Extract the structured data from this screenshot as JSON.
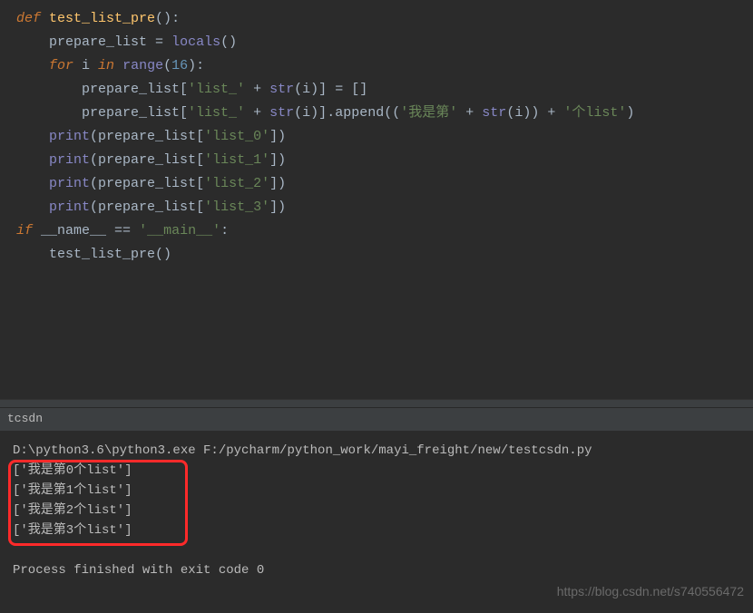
{
  "code": {
    "lines": [
      {
        "indent": 0,
        "tokens": [
          [
            "kw",
            "def "
          ],
          [
            "fn",
            "test_list_pre"
          ],
          [
            "paren",
            "()"
          ],
          [
            "op",
            ":"
          ]
        ]
      },
      {
        "indent": 1,
        "tokens": [
          [
            "",
            "prepare_list "
          ],
          [
            "op",
            "="
          ],
          [
            "",
            " "
          ],
          [
            "builtin",
            "locals"
          ],
          [
            "paren",
            "()"
          ]
        ]
      },
      {
        "indent": 1,
        "tokens": [
          [
            "kw",
            "for "
          ],
          [
            "",
            "i "
          ],
          [
            "kw",
            "in "
          ],
          [
            "builtin",
            "range"
          ],
          [
            "paren",
            "("
          ],
          [
            "num",
            "16"
          ],
          [
            "paren",
            ")"
          ],
          [
            "op",
            ":"
          ]
        ]
      },
      {
        "indent": 2,
        "tokens": [
          [
            "",
            "prepare_list"
          ],
          [
            "bracket",
            "["
          ],
          [
            "str",
            "'list_'"
          ],
          [
            "",
            " "
          ],
          [
            "op",
            "+"
          ],
          [
            "",
            " "
          ],
          [
            "builtin",
            "str"
          ],
          [
            "paren",
            "("
          ],
          [
            "",
            "i"
          ],
          [
            "paren",
            ")"
          ],
          [
            "bracket",
            "]"
          ],
          [
            "",
            " "
          ],
          [
            "op",
            "="
          ],
          [
            "",
            " "
          ],
          [
            "bracket",
            "[]"
          ]
        ]
      },
      {
        "indent": 2,
        "tokens": [
          [
            "",
            "prepare_list"
          ],
          [
            "bracket",
            "["
          ],
          [
            "str",
            "'list_'"
          ],
          [
            "",
            " "
          ],
          [
            "op",
            "+"
          ],
          [
            "",
            " "
          ],
          [
            "builtin",
            "str"
          ],
          [
            "paren",
            "("
          ],
          [
            "",
            "i"
          ],
          [
            "paren",
            ")"
          ],
          [
            "bracket",
            "]"
          ],
          [
            "dot",
            "."
          ],
          [
            "",
            "append"
          ],
          [
            "paren",
            "(("
          ],
          [
            "str",
            "'我是第'"
          ],
          [
            "",
            " "
          ],
          [
            "op",
            "+"
          ],
          [
            "",
            " "
          ],
          [
            "builtin",
            "str"
          ],
          [
            "paren",
            "("
          ],
          [
            "",
            "i"
          ],
          [
            "paren",
            "))"
          ],
          [
            "",
            " "
          ],
          [
            "op",
            "+"
          ],
          [
            "",
            " "
          ],
          [
            "str",
            "'个list'"
          ],
          [
            "paren",
            ")"
          ]
        ]
      },
      {
        "indent": 1,
        "tokens": [
          [
            "builtin",
            "print"
          ],
          [
            "paren",
            "("
          ],
          [
            "",
            "prepare_list"
          ],
          [
            "bracket",
            "["
          ],
          [
            "str",
            "'list_0'"
          ],
          [
            "bracket",
            "]"
          ],
          [
            "paren",
            ")"
          ]
        ]
      },
      {
        "indent": 1,
        "tokens": [
          [
            "builtin",
            "print"
          ],
          [
            "paren",
            "("
          ],
          [
            "",
            "prepare_list"
          ],
          [
            "bracket",
            "["
          ],
          [
            "str",
            "'list_1'"
          ],
          [
            "bracket",
            "]"
          ],
          [
            "paren",
            ")"
          ]
        ]
      },
      {
        "indent": 1,
        "tokens": [
          [
            "builtin",
            "print"
          ],
          [
            "paren",
            "("
          ],
          [
            "",
            "prepare_list"
          ],
          [
            "bracket",
            "["
          ],
          [
            "str",
            "'list_2'"
          ],
          [
            "bracket",
            "]"
          ],
          [
            "paren",
            ")"
          ]
        ]
      },
      {
        "indent": 1,
        "tokens": [
          [
            "builtin",
            "print"
          ],
          [
            "paren",
            "("
          ],
          [
            "",
            "prepare_list"
          ],
          [
            "bracket",
            "["
          ],
          [
            "str",
            "'list_3'"
          ],
          [
            "bracket",
            "]"
          ],
          [
            "paren",
            ")"
          ]
        ]
      },
      {
        "indent": 0,
        "tokens": [
          [
            "",
            ""
          ]
        ]
      },
      {
        "indent": 0,
        "tokens": [
          [
            "kw",
            "if "
          ],
          [
            "",
            "__name__ "
          ],
          [
            "op",
            "=="
          ],
          [
            "",
            " "
          ],
          [
            "str",
            "'__main__'"
          ],
          [
            "op",
            ":"
          ]
        ]
      },
      {
        "indent": 1,
        "tokens": [
          [
            "",
            "test_list_pre"
          ],
          [
            "paren",
            "()"
          ]
        ]
      }
    ]
  },
  "tab": {
    "name": "tcsdn"
  },
  "console": {
    "lines": [
      "D:\\python3.6\\python3.exe F:/pycharm/python_work/mayi_freight/new/testcsdn.py",
      "['我是第0个list']",
      "['我是第1个list']",
      "['我是第2个list']",
      "['我是第3个list']",
      "",
      "Process finished with exit code 0"
    ]
  },
  "watermark": "https://blog.csdn.net/s740556472"
}
